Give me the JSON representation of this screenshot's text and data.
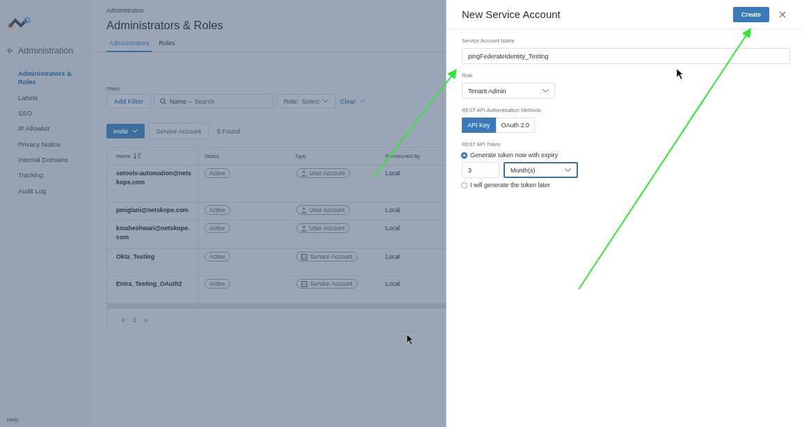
{
  "sidebar": {
    "back_label": "Administration",
    "items": [
      {
        "label": "Administrators & Roles",
        "selected": true
      },
      {
        "label": "Labels",
        "selected": false
      },
      {
        "label": "SSO",
        "selected": false
      },
      {
        "label": "IP Allowlist",
        "selected": false
      },
      {
        "label": "Privacy Notice",
        "selected": false
      },
      {
        "label": "Internal Domains",
        "selected": false
      },
      {
        "label": "Tracking",
        "selected": false
      },
      {
        "label": "Audit Log",
        "selected": false
      }
    ],
    "help": "Help"
  },
  "page": {
    "breadcrumb": "Administration",
    "title": "Administrators & Roles",
    "tabs": [
      {
        "label": "Administrators",
        "selected": true
      },
      {
        "label": "Roles",
        "selected": false
      }
    ],
    "filters": {
      "label": "Filters",
      "add_filter": "Add Filter",
      "name_label": "Name –",
      "name_placeholder": "Search",
      "role_label": "Role:",
      "role_value": "Select",
      "clear": "Clear"
    },
    "invite": "Invite",
    "service_account": "Service Account",
    "found": "5 Found",
    "table": {
      "columns": [
        "Name",
        "Status",
        "Type",
        "Provisioned By"
      ],
      "rows": [
        {
          "name": "setools-automation@netskope.com",
          "status": "Active",
          "type": "User Account",
          "kind": "user",
          "provisioned_by": "Local"
        },
        {
          "name": "pmiglani@netskope.com",
          "status": "Active",
          "type": "User Account",
          "kind": "user",
          "provisioned_by": "Local"
        },
        {
          "name": "kmaheshwari@netskope.com",
          "status": "Active",
          "type": "User Account",
          "kind": "user",
          "provisioned_by": "Local"
        },
        {
          "name": "Okta_Testing",
          "status": "Active",
          "type": "Service Account",
          "kind": "service",
          "provisioned_by": "Local"
        },
        {
          "name": "Entra_Testing_OAuth2",
          "status": "Active",
          "type": "Service Account",
          "kind": "service",
          "provisioned_by": "Local"
        }
      ]
    },
    "pagination": {
      "page": "1"
    }
  },
  "panel": {
    "title": "New Service Account",
    "create": "Create",
    "name_label": "Service Account Name",
    "name_value": "pingFederateIdentity_Testing",
    "role_label": "Role",
    "role_value": "Tenant Admin",
    "auth_label": "REST API Authentication Methods",
    "auth_methods": [
      {
        "label": "API Key",
        "selected": true
      },
      {
        "label": "OAuth 2.0",
        "selected": false
      }
    ],
    "token_label": "REST API Token",
    "token_options": [
      {
        "label": "Generate token now with expiry",
        "selected": true
      },
      {
        "label": "I will generate the token later",
        "selected": false
      }
    ],
    "expiry_value": "3",
    "expiry_unit": "Month(s)"
  }
}
